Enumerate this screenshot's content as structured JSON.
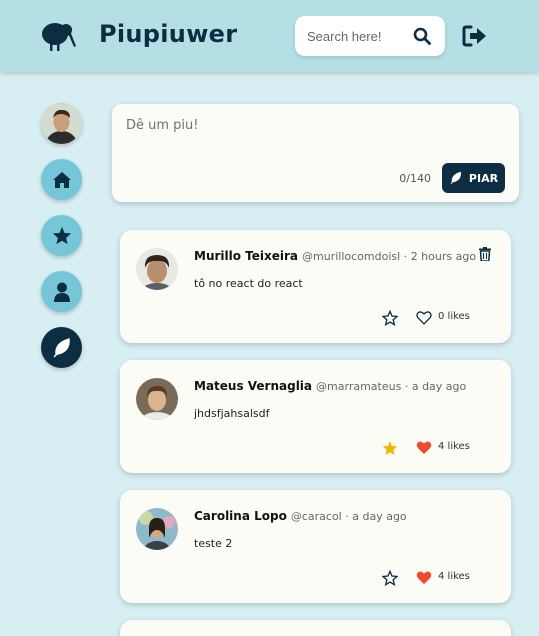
{
  "header": {
    "brand": "Piupiuwer",
    "logo_icon": "kiwi-bird-icon",
    "search_placeholder": "Search here!",
    "search_icon": "search-icon",
    "logout_icon": "sign-out-icon"
  },
  "sidebar": {
    "items": [
      {
        "name": "profile-avatar"
      },
      {
        "name": "home",
        "icon": "home-icon"
      },
      {
        "name": "favorites",
        "icon": "star-icon"
      },
      {
        "name": "profile",
        "icon": "user-icon"
      },
      {
        "name": "piu",
        "icon": "feather-icon"
      }
    ]
  },
  "composer": {
    "placeholder": "Dê um piu!",
    "counter": "0/140",
    "button_label": "PIAR"
  },
  "posts": [
    {
      "author": "Murillo Teixeira",
      "handle": "@murillocomdoisl",
      "time": "2 hours ago",
      "text": "tô no react do react",
      "favorited": false,
      "liked": false,
      "likes": "0 likes",
      "deletable": true
    },
    {
      "author": "Mateus Vernaglia",
      "handle": "@marramateus",
      "time": "a day ago",
      "text": "jhdsfjahsalsdf",
      "favorited": true,
      "liked": true,
      "likes": "4 likes",
      "deletable": false
    },
    {
      "author": "Carolina Lopo",
      "handle": "@caracol",
      "time": "a day ago",
      "text": "teste 2",
      "favorited": false,
      "liked": true,
      "likes": "4 likes",
      "deletable": false
    }
  ],
  "colors": {
    "background": "#d7eef2",
    "topbar": "#b3dfe5",
    "navy": "#0d2d42",
    "sidebar_button": "#74c6d8",
    "card": "#fcfcf6",
    "like_red": "#ef4b2e",
    "star_gold": "#f5b400"
  }
}
